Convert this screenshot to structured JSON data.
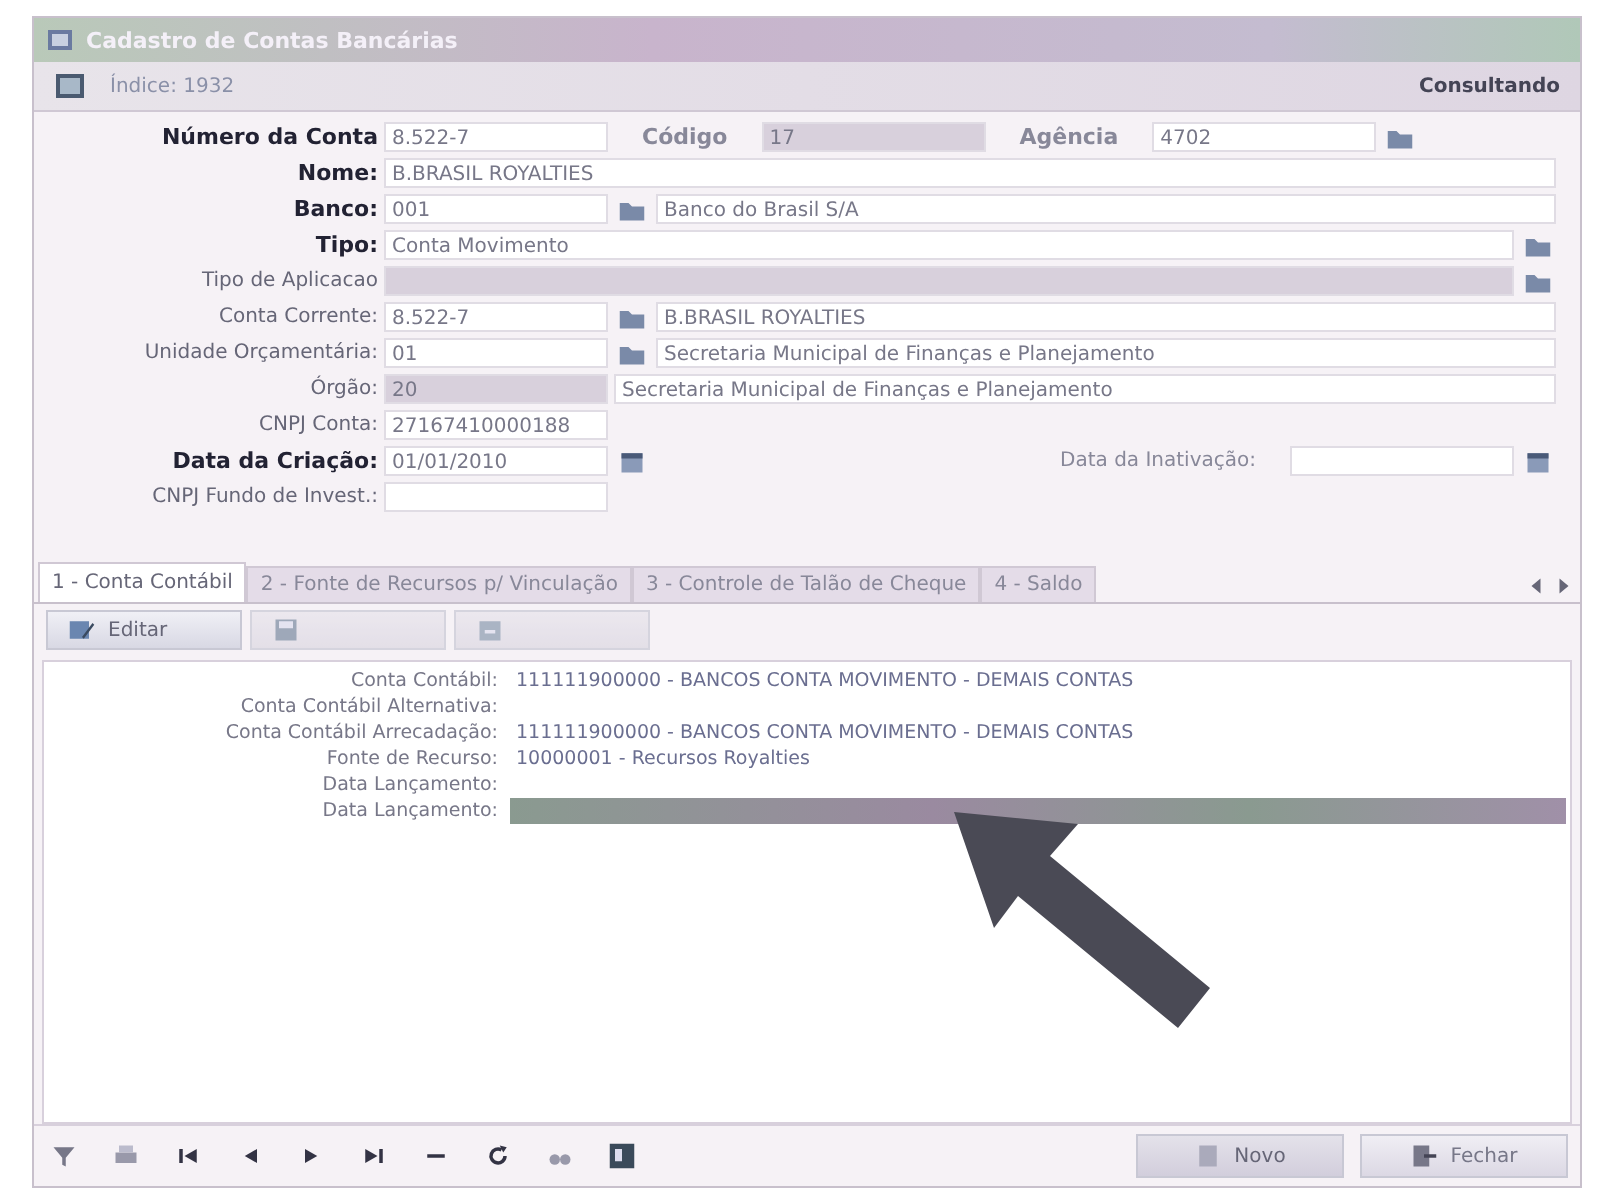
{
  "window": {
    "title": "Cadastro de Contas Bancárias"
  },
  "info_bar": {
    "index": "Índice: 1932",
    "mode": "Consultando"
  },
  "form_rows": [
    {
      "label": "Número da Conta",
      "bold": true,
      "items": [
        {
          "kind": "code",
          "value": "8.522-7",
          "readonly": false
        },
        {
          "kind": "label",
          "text": "Código",
          "bold": true
        },
        {
          "kind": "code",
          "value": "17",
          "readonly": true
        },
        {
          "kind": "label",
          "text": "Agência",
          "bold": true
        },
        {
          "kind": "code",
          "value": "4702",
          "readonly": false
        },
        {
          "kind": "lookup"
        }
      ]
    },
    {
      "label": "Nome:",
      "bold": true,
      "items": [
        {
          "kind": "text",
          "value": "B.BRASIL ROYALTIES",
          "readonly": false
        }
      ]
    },
    {
      "label": "Banco:",
      "bold": true,
      "items": [
        {
          "kind": "code",
          "value": "001",
          "readonly": false
        },
        {
          "kind": "lookup"
        },
        {
          "kind": "text",
          "value": "Banco do Brasil S/A",
          "readonly": false
        }
      ]
    },
    {
      "label": "Tipo:",
      "bold": true,
      "items": [
        {
          "kind": "text",
          "value": "Conta Movimento",
          "readonly": false
        },
        {
          "kind": "lookup"
        }
      ]
    },
    {
      "label": "Tipo de Aplicacao",
      "bold": false,
      "items": [
        {
          "kind": "text",
          "readonly": true
        },
        {
          "kind": "lookup"
        }
      ]
    },
    {
      "label": "Conta Corrente:",
      "bold": false,
      "items": [
        {
          "kind": "code",
          "value": "8.522-7",
          "readonly": false
        },
        {
          "kind": "lookup"
        },
        {
          "kind": "text",
          "value": "B.BRASIL ROYALTIES",
          "readonly": false
        }
      ]
    },
    {
      "label": "Unidade Orçamentária:",
      "bold": false,
      "items": [
        {
          "kind": "code",
          "value": "01",
          "readonly": false
        },
        {
          "kind": "lookup"
        },
        {
          "kind": "text",
          "value": "Secretaria Municipal de Finanças e Planejamento",
          "readonly": false
        }
      ]
    },
    {
      "label": "Órgão:",
      "bold": false,
      "items": [
        {
          "kind": "code",
          "value": "20",
          "readonly": true
        },
        {
          "kind": "text",
          "value": "Secretaria Municipal de Finanças e Planejamento",
          "readonly": false
        }
      ]
    },
    {
      "label": "CNPJ Conta:",
      "bold": false,
      "items": [
        {
          "kind": "code",
          "value": "27167410000188",
          "readonly": false
        }
      ]
    },
    {
      "label": "Data da Criação:",
      "bold": true,
      "items": [
        {
          "kind": "code",
          "value": "01/01/2010",
          "readonly": false
        },
        {
          "kind": "calendar"
        },
        {
          "kind": "push"
        },
        {
          "kind": "label",
          "text": "Data da Inativação:",
          "bold": false
        },
        {
          "kind": "code",
          "readonly": false
        },
        {
          "kind": "calendar"
        }
      ]
    },
    {
      "label": "CNPJ Fundo de Invest.:",
      "bold": false,
      "items": [
        {
          "kind": "code",
          "readonly": false
        }
      ]
    }
  ],
  "tabs": [
    {
      "label": "1 - Conta Contábil",
      "selected": true
    },
    {
      "label": "2 - Fonte de Recursos p/ Vinculação",
      "selected": false
    },
    {
      "label": "3 - Controle de Talão de Cheque",
      "selected": false
    },
    {
      "label": "4 - Saldo",
      "selected": false
    }
  ],
  "toolbar": [
    {
      "kind": "edit",
      "label": "Editar",
      "disabled": false
    },
    {
      "kind": "save",
      "disabled": true
    },
    {
      "kind": "cancel",
      "disabled": true
    }
  ],
  "details": [
    {
      "label": "Conta Contábil:",
      "value": "111111900000 - BANCOS CONTA MOVIMENTO - DEMAIS CONTAS",
      "highlighted": false
    },
    {
      "label": "Conta Contábil Alternativa:",
      "highlighted": false
    },
    {
      "label": "Conta Contábil Arrecadação:",
      "value": "111111900000 - BANCOS CONTA MOVIMENTO - DEMAIS CONTAS",
      "highlighted": false
    },
    {
      "label": "Fonte de Recurso:",
      "value": "10000001 - Recursos Royalties",
      "highlighted": false
    },
    {
      "label": "Data Lançamento:",
      "highlighted": false
    },
    {
      "label": "Data Lançamento:",
      "highlighted": true
    }
  ],
  "navigator": [
    {
      "kind": "filter"
    },
    {
      "kind": "print"
    },
    {
      "kind": "first"
    },
    {
      "kind": "prev"
    },
    {
      "kind": "next"
    },
    {
      "kind": "last"
    },
    {
      "kind": "delete"
    },
    {
      "kind": "refresh"
    },
    {
      "kind": "search"
    },
    {
      "kind": "square"
    }
  ],
  "buttons": [
    {
      "kind": "new",
      "label": "Novo",
      "disabled": true
    },
    {
      "kind": "close",
      "label": "Fechar",
      "disabled": false
    }
  ]
}
